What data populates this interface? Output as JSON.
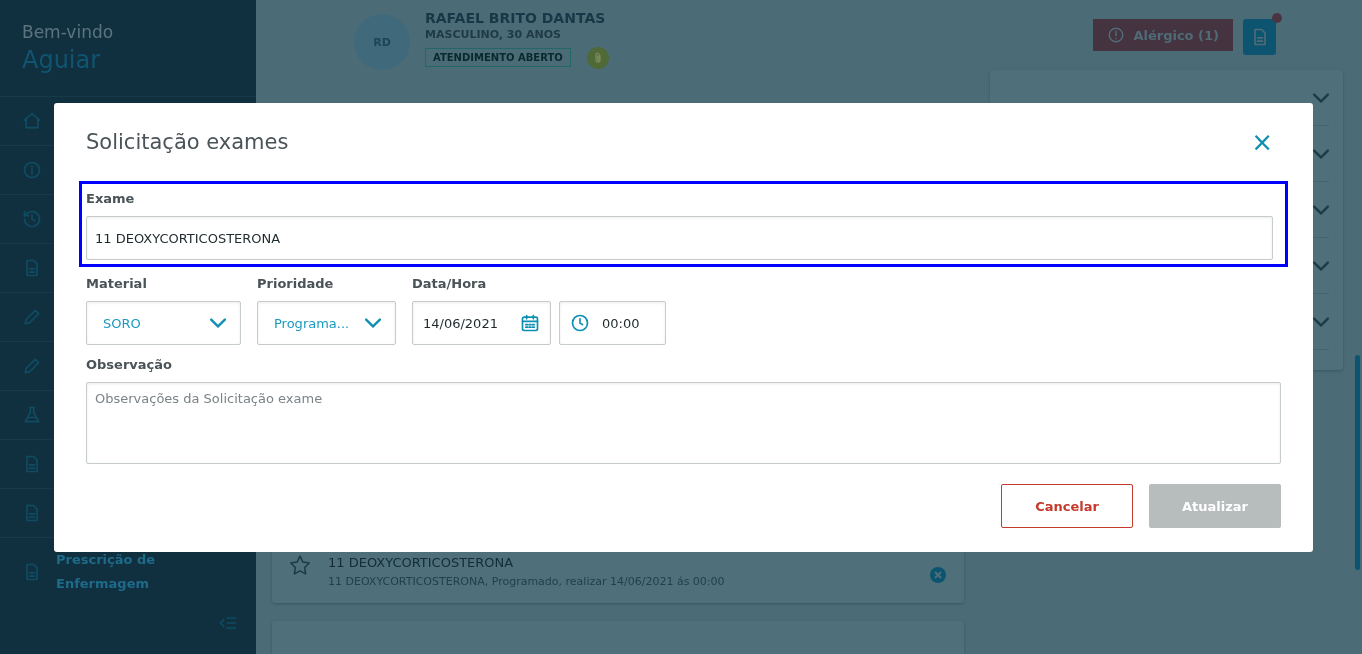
{
  "sidebar": {
    "greeting": "Bem-vindo",
    "user": "Aguiar",
    "items": [
      {
        "label": "Prescrição de Enfermagem"
      }
    ]
  },
  "patient": {
    "initials": "RD",
    "name": "RAFAEL BRITO DANTAS",
    "details": "MASCULINO, 30 ANOS",
    "status": "ATENDIMENTO ABERTO"
  },
  "header_actions": {
    "allergy": "Alérgico (1)",
    "document_notification": true
  },
  "exam_card": {
    "title": "11 DEOXYCORTICOSTERONA",
    "subtitle": "11 DEOXYCORTICOSTERONA, Programado, realizar 14/06/2021 ás 00:00"
  },
  "dialog": {
    "title": "Solicitação exames",
    "close": "×",
    "exam": {
      "label": "Exame",
      "value": "11 DEOXYCORTICOSTERONA",
      "highlighted": true
    },
    "material": {
      "label": "Material",
      "value": "SORO"
    },
    "priority": {
      "label": "Prioridade",
      "value": "Programa..."
    },
    "datetime": {
      "label": "Data/Hora",
      "date": "14/06/2021",
      "time": "00:00"
    },
    "notes": {
      "label": "Observação",
      "placeholder": "Observações da Solicitação exame"
    },
    "buttons": [
      {
        "label": "Cancelar",
        "kind": "secondary",
        "disabled": false
      },
      {
        "label": "Atualizar",
        "kind": "primary",
        "disabled": true
      }
    ]
  }
}
